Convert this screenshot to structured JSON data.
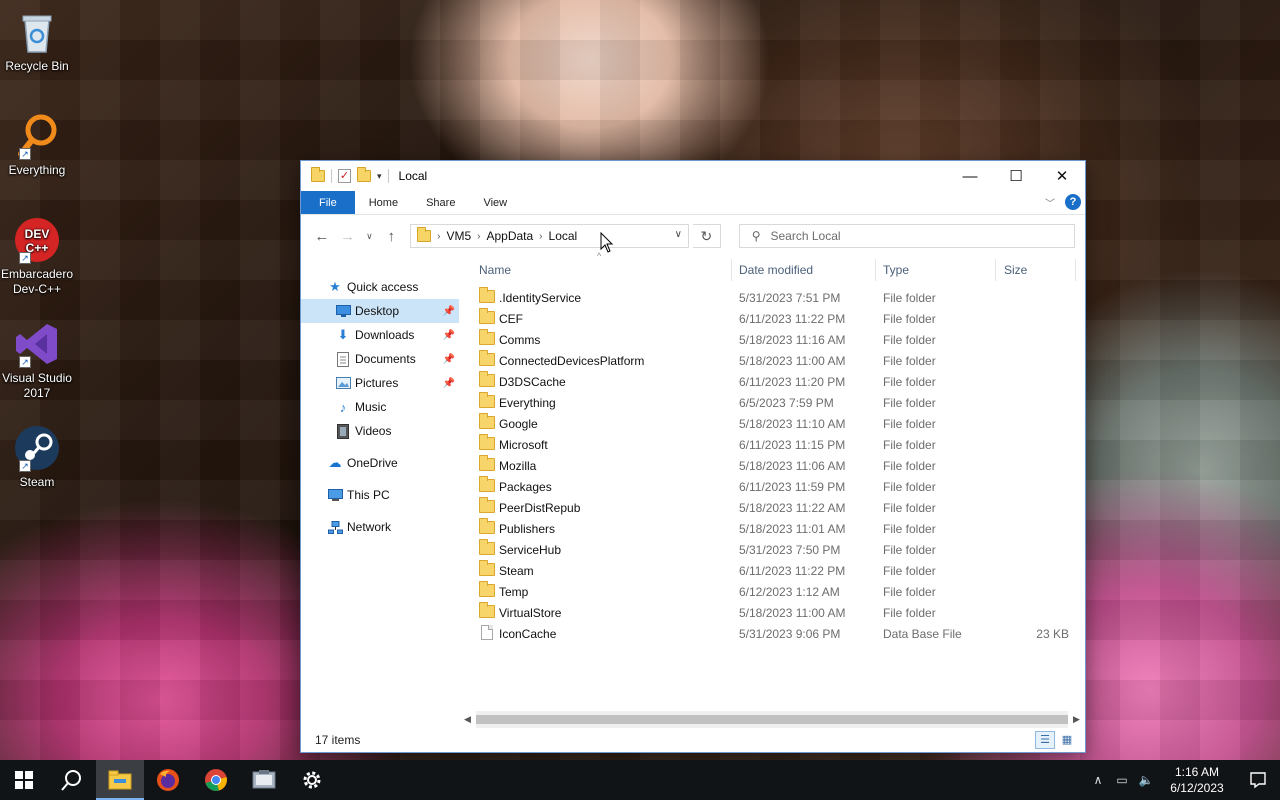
{
  "desktop": {
    "icons": [
      {
        "label": "Recycle Bin"
      },
      {
        "label": "Everything"
      },
      {
        "label": "Embarcadero Dev-C++"
      },
      {
        "label": "Visual Studio 2017"
      },
      {
        "label": "Steam"
      }
    ]
  },
  "window": {
    "title": "Local",
    "controls": {
      "minimize": "—",
      "maximize": "☐",
      "close": "✕"
    },
    "ribbon_tabs": [
      "File",
      "Home",
      "Share",
      "View"
    ],
    "address": {
      "crumbs": [
        "VM5",
        "AppData",
        "Local"
      ]
    },
    "search": {
      "placeholder": "Search Local"
    },
    "nav": {
      "quick_access": "Quick access",
      "items": [
        {
          "label": "Desktop",
          "pinned": true,
          "selected": true
        },
        {
          "label": "Downloads",
          "pinned": true
        },
        {
          "label": "Documents",
          "pinned": true
        },
        {
          "label": "Pictures",
          "pinned": true
        },
        {
          "label": "Music"
        },
        {
          "label": "Videos"
        }
      ],
      "onedrive": "OneDrive",
      "this_pc": "This PC",
      "network": "Network"
    },
    "columns": {
      "name": "Name",
      "date": "Date modified",
      "type": "Type",
      "size": "Size"
    },
    "files": [
      {
        "name": ".IdentityService",
        "date": "5/31/2023 7:51 PM",
        "type": "File folder",
        "size": ""
      },
      {
        "name": "CEF",
        "date": "6/11/2023 11:22 PM",
        "type": "File folder",
        "size": ""
      },
      {
        "name": "Comms",
        "date": "5/18/2023 11:16 AM",
        "type": "File folder",
        "size": ""
      },
      {
        "name": "ConnectedDevicesPlatform",
        "date": "5/18/2023 11:00 AM",
        "type": "File folder",
        "size": ""
      },
      {
        "name": "D3DSCache",
        "date": "6/11/2023 11:20 PM",
        "type": "File folder",
        "size": ""
      },
      {
        "name": "Everything",
        "date": "6/5/2023 7:59 PM",
        "type": "File folder",
        "size": ""
      },
      {
        "name": "Google",
        "date": "5/18/2023 11:10 AM",
        "type": "File folder",
        "size": ""
      },
      {
        "name": "Microsoft",
        "date": "6/11/2023 11:15 PM",
        "type": "File folder",
        "size": ""
      },
      {
        "name": "Mozilla",
        "date": "5/18/2023 11:06 AM",
        "type": "File folder",
        "size": ""
      },
      {
        "name": "Packages",
        "date": "6/11/2023 11:59 PM",
        "type": "File folder",
        "size": ""
      },
      {
        "name": "PeerDistRepub",
        "date": "5/18/2023 11:22 AM",
        "type": "File folder",
        "size": ""
      },
      {
        "name": "Publishers",
        "date": "5/18/2023 11:01 AM",
        "type": "File folder",
        "size": ""
      },
      {
        "name": "ServiceHub",
        "date": "5/31/2023 7:50 PM",
        "type": "File folder",
        "size": ""
      },
      {
        "name": "Steam",
        "date": "6/11/2023 11:22 PM",
        "type": "File folder",
        "size": ""
      },
      {
        "name": "Temp",
        "date": "6/12/2023 1:12 AM",
        "type": "File folder",
        "size": ""
      },
      {
        "name": "VirtualStore",
        "date": "5/18/2023 11:00 AM",
        "type": "File folder",
        "size": ""
      },
      {
        "name": "IconCache",
        "date": "5/31/2023 9:06 PM",
        "type": "Data Base File",
        "size": "23 KB"
      }
    ],
    "status": {
      "item_count": "17 items"
    }
  },
  "taskbar": {
    "clock_time": "1:16 AM",
    "clock_date": "6/12/2023",
    "accent": "#1a6fc9"
  }
}
